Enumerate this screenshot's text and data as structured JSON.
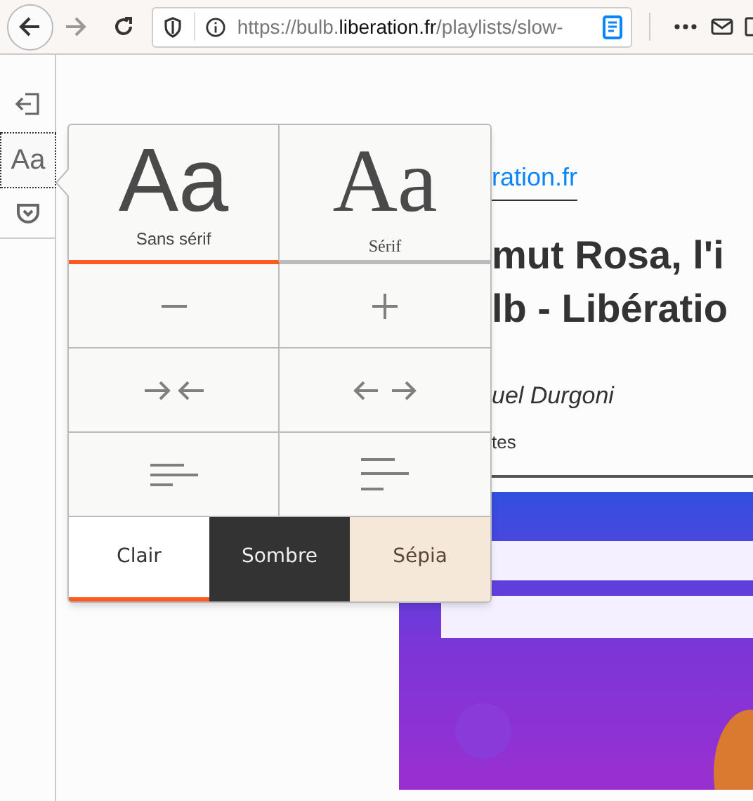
{
  "toolbar": {
    "url": {
      "scheme": "https://bulb.",
      "domain": "liberation.fr",
      "path": "/playlists/slow-"
    }
  },
  "sidebar": {
    "items": [
      {
        "kind": "close"
      },
      {
        "kind": "type",
        "label": "Aa",
        "selected": true
      },
      {
        "kind": "pocket"
      }
    ]
  },
  "popup": {
    "fonts": [
      {
        "kind": "sans",
        "sample": "Aa",
        "label": "Sans sérif",
        "selected": true
      },
      {
        "kind": "serif",
        "sample": "Aa",
        "label": "Sérif",
        "selected": false
      }
    ],
    "controls": [
      {
        "kind": "minus"
      },
      {
        "kind": "plus"
      },
      {
        "kind": "narrow"
      },
      {
        "kind": "widen"
      },
      {
        "kind": "line-tight"
      },
      {
        "kind": "line-loose"
      }
    ],
    "themes": [
      {
        "kind": "light",
        "label": "Clair",
        "selected": true
      },
      {
        "kind": "dark",
        "label": "Sombre",
        "selected": false
      },
      {
        "kind": "sepia",
        "label": "Sépia",
        "selected": false
      }
    ]
  },
  "article": {
    "domain": "ration.fr",
    "title_lines": [
      "mut Rosa, l'i",
      "lb - Libératio"
    ],
    "author": "uel Durgoni",
    "meta": "tes"
  }
}
